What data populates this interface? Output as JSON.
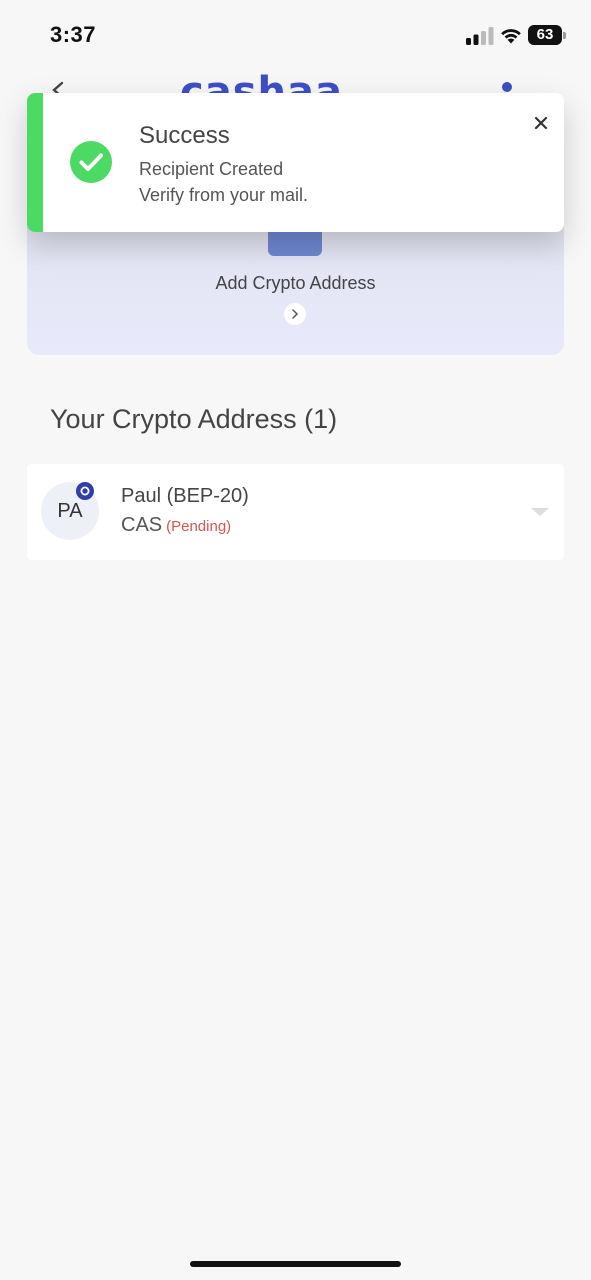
{
  "status_bar": {
    "time": "3:37",
    "battery": "63"
  },
  "header": {
    "brand": "cashaa"
  },
  "add_card": {
    "label": "Add Crypto Address"
  },
  "toast": {
    "title": "Success",
    "line1": "Recipient Created",
    "line2": "Verify from your mail.",
    "accent_color": "#4cd964"
  },
  "section": {
    "title": "Your Crypto Address (1)"
  },
  "addresses": [
    {
      "initials": "PA",
      "name": "Paul (BEP-20)",
      "currency": "CAS",
      "status": "(Pending)"
    }
  ],
  "colors": {
    "brand": "#3d4fc4",
    "pending": "#d9534f",
    "success": "#4cd964"
  },
  "icons": {
    "back": "back-arrow-icon",
    "menu": "vertical-dots-icon",
    "wallet": "wallet-icon",
    "success": "check-circle-icon",
    "close": "close-icon",
    "network": "network-badge-icon",
    "expand": "chevron-down-icon"
  }
}
